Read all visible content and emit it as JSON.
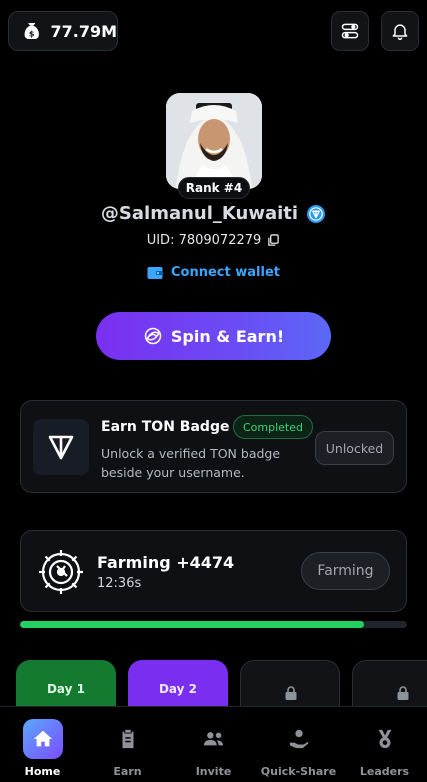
{
  "header": {
    "balance": "77.79M",
    "balance_icon": "money-bag-icon",
    "settings_icon": "settings-sliders-icon",
    "notification_icon": "bell-icon"
  },
  "profile": {
    "rank_label": "Rank #4",
    "username": "@Salmanul_Kuwaiti",
    "uid_label": "UID: 7809072279",
    "connect_wallet_label": "Connect wallet"
  },
  "spin": {
    "label": "Spin & Earn!"
  },
  "ton_badge": {
    "title": "Earn TON Badge",
    "status": "Completed",
    "description": "Unlock a verified TON badge beside your username.",
    "button_label": "Unlocked"
  },
  "farming": {
    "title": "Farming +4474",
    "time": "12:36s",
    "button_label": "Farming",
    "progress_fraction": 0.89
  },
  "days": [
    {
      "label": "Day 1"
    },
    {
      "label": "Day 2"
    },
    {
      "label": ""
    },
    {
      "label": ""
    }
  ],
  "nav": {
    "items": [
      {
        "label": "Home",
        "icon": "home-icon"
      },
      {
        "label": "Earn",
        "icon": "clipboard-icon"
      },
      {
        "label": "Invite",
        "icon": "users-icon"
      },
      {
        "label": "Quick-Share",
        "icon": "hand-coin-icon"
      },
      {
        "label": "Leaders",
        "icon": "medal-icon"
      }
    ]
  },
  "colors": {
    "accent_purple": "#7a2ff0",
    "link_blue": "#3aa7ff",
    "success_green": "#22d160",
    "card_bg": "#0e1014"
  }
}
